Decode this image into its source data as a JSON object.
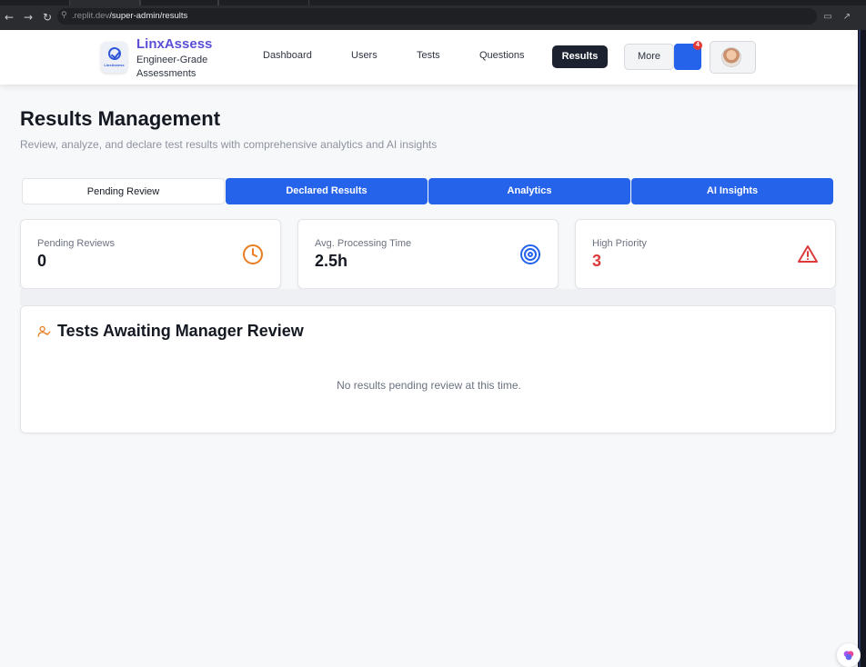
{
  "browser": {
    "url_prefix": ".replit.dev",
    "url_path": "/super-admin/results",
    "back_glyph": "←",
    "forward_glyph": "→",
    "reload_glyph": "↻"
  },
  "header": {
    "brand_name": "LinxAssess",
    "brand_tagline": "Engineer-Grade Assessments",
    "logo_text": "LinxAssess",
    "nav": {
      "dashboard": "Dashboard",
      "users": "Users",
      "tests": "Tests",
      "questions": "Questions",
      "results": "Results",
      "more": "More"
    },
    "notification_count": "4"
  },
  "page": {
    "title": "Results Management",
    "subtitle": "Review, analyze, and declare test results with comprehensive analytics and AI insights"
  },
  "tabs": {
    "pending": "Pending Review",
    "declared": "Declared Results",
    "analytics": "Analytics",
    "ai": "AI Insights",
    "active": "Pending Review"
  },
  "stats": {
    "pending_label": "Pending Reviews",
    "pending_value": "0",
    "avg_label": "Avg. Processing Time",
    "avg_value": "2.5h",
    "priority_label": "High Priority",
    "priority_value": "3"
  },
  "panel": {
    "title": "Tests Awaiting Manager Review",
    "empty_message": "No results pending review at this time."
  },
  "colors": {
    "accent_blue": "#2563eb",
    "brand_purple": "#5a4fd6",
    "clock_orange": "#ea7c1f",
    "alert_red": "#dc3b3b",
    "nav_active_dark": "#1c2230"
  }
}
